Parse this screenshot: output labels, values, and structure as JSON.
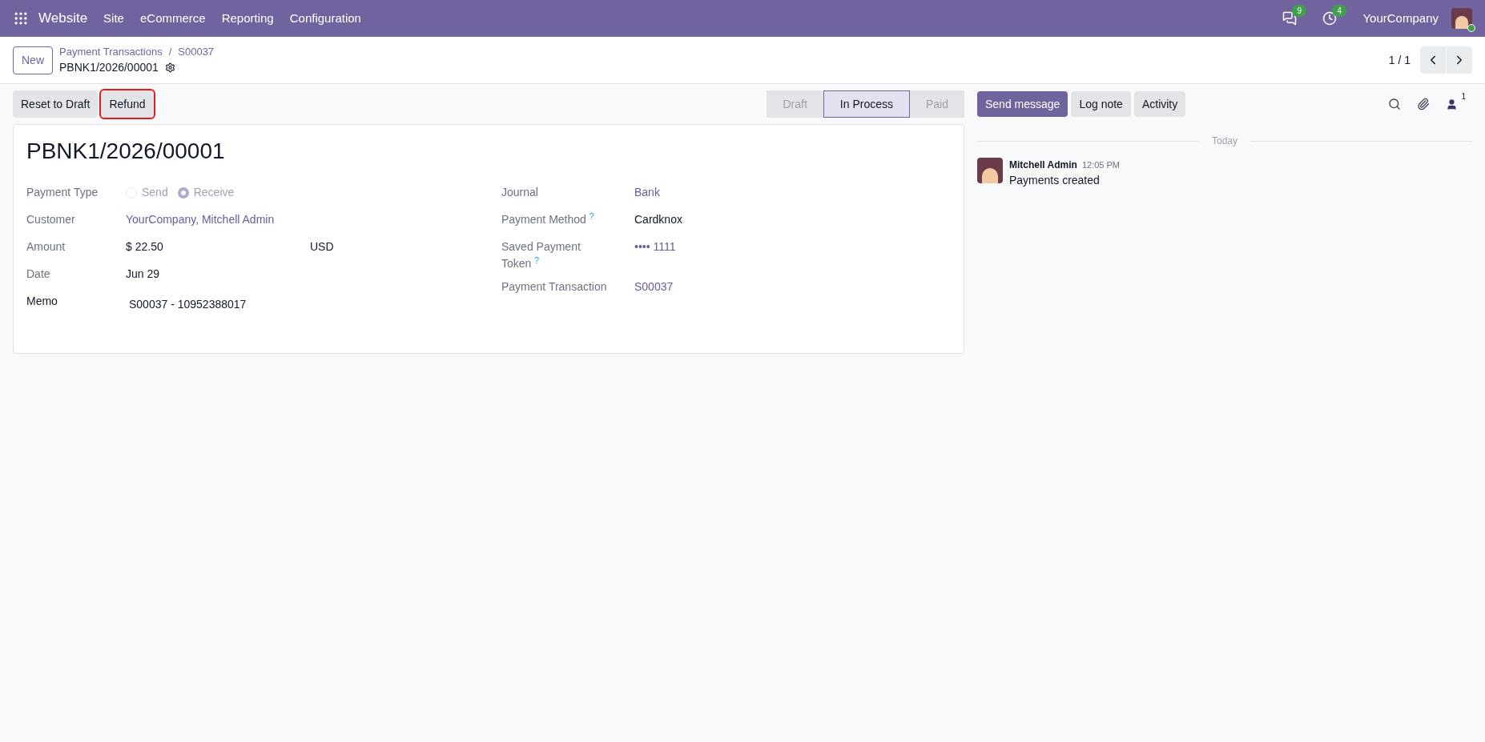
{
  "navbar": {
    "app": "Website",
    "menu": [
      "Site",
      "eCommerce",
      "Reporting",
      "Configuration"
    ],
    "messages_count": "9",
    "activities_count": "4",
    "company": "YourCompany"
  },
  "control_panel": {
    "new_button": "New",
    "breadcrumbs": [
      "Payment Transactions",
      "S00037"
    ],
    "breadcrumb_separator": "/",
    "record": "PBNK1/2026/00001",
    "pager": "1 / 1"
  },
  "actions": [
    {
      "label": "Reset to Draft",
      "highlighted": false
    },
    {
      "label": "Refund",
      "highlighted": true
    }
  ],
  "statusbar": [
    {
      "label": "Draft",
      "selected": false
    },
    {
      "label": "In Process",
      "selected": true
    },
    {
      "label": "Paid",
      "selected": false
    }
  ],
  "form": {
    "title": "PBNK1/2026/00001",
    "left": [
      {
        "kind": "radio",
        "label": "Payment Type",
        "options": [
          {
            "label": "Send",
            "selected": false
          },
          {
            "label": "Receive",
            "selected": true
          }
        ]
      },
      {
        "kind": "link",
        "label": "Customer",
        "value": "YourCompany, Mitchell Admin"
      },
      {
        "kind": "amount",
        "label": "Amount",
        "value": "$ 22.50",
        "currency": "USD"
      },
      {
        "kind": "text",
        "label": "Date",
        "value": "Jun 29"
      },
      {
        "kind": "memo",
        "label": "Memo",
        "value": "S00037 - 10952388017"
      }
    ],
    "right": [
      {
        "kind": "link",
        "label": "Journal",
        "value": "Bank"
      },
      {
        "kind": "text",
        "label": "Payment Method",
        "help": "?",
        "value": "Cardknox"
      },
      {
        "kind": "link",
        "label": "Saved Payment Token",
        "help": "?",
        "value": "•••• 1111"
      },
      {
        "kind": "link",
        "label": "Payment Transaction",
        "value": "S00037"
      }
    ]
  },
  "chatter": {
    "buttons": [
      {
        "label": "Send message",
        "selected": true
      },
      {
        "label": "Log note",
        "selected": false
      },
      {
        "label": "Activity",
        "selected": false
      }
    ],
    "followers_count": "1",
    "separator": "Today",
    "messages": [
      {
        "author": "Mitchell Admin",
        "time": "12:05 PM",
        "body": "Payments created"
      }
    ]
  }
}
